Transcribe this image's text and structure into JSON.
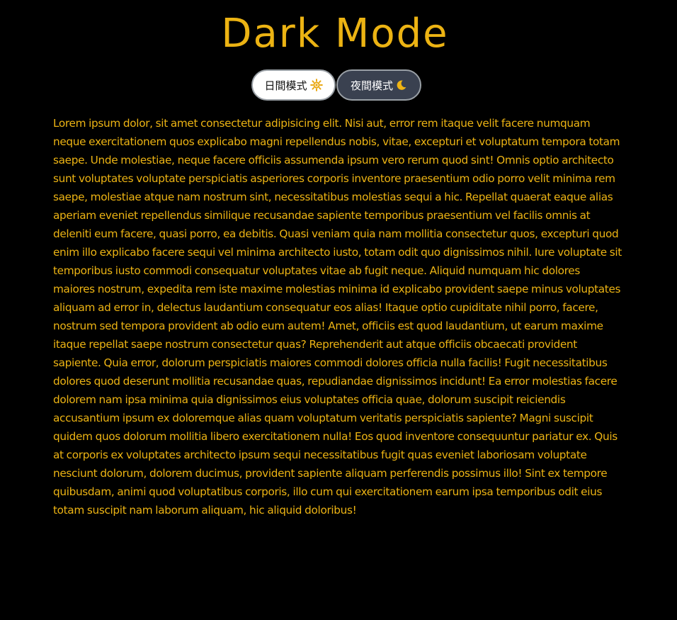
{
  "header": {
    "title": "Dark Mode"
  },
  "mode_toggle": {
    "light_label": "日間模式",
    "light_icon": "sun-icon",
    "dark_label": "夜間模式",
    "dark_icon": "moon-icon",
    "active": "dark"
  },
  "colors": {
    "background": "#000000",
    "accent": "#ecb313",
    "dark_button": "#3a4150",
    "light_button": "#ffffff"
  },
  "content": {
    "paragraph": "Lorem ipsum dolor, sit amet consectetur adipisicing elit. Nisi aut, error rem itaque velit facere numquam neque exercitationem quos explicabo magni repellendus nobis, vitae, excepturi et voluptatum tempora totam saepe. Unde molestiae, neque facere officiis assumenda ipsum vero rerum quod sint! Omnis optio architecto sunt voluptates voluptate perspiciatis asperiores corporis inventore praesentium odio porro velit minima rem saepe, molestiae atque nam nostrum sint, necessitatibus molestias sequi a hic. Repellat quaerat eaque alias aperiam eveniet repellendus similique recusandae sapiente temporibus praesentium vel facilis omnis at deleniti eum facere, quasi porro, ea debitis. Quasi veniam quia nam mollitia consectetur quos, excepturi quod enim illo explicabo facere sequi vel minima architecto iusto, totam odit quo dignissimos nihil. Iure voluptate sit temporibus iusto commodi consequatur voluptates vitae ab fugit neque. Aliquid numquam hic dolores maiores nostrum, expedita rem iste maxime molestias minima id explicabo provident saepe minus voluptates aliquam ad error in, delectus laudantium consequatur eos alias! Itaque optio cupiditate nihil porro, facere, nostrum sed tempora provident ab odio eum autem! Amet, officiis est quod laudantium, ut earum maxime itaque repellat saepe nostrum consectetur quas? Reprehenderit aut atque officiis obcaecati provident sapiente. Quia error, dolorum perspiciatis maiores commodi dolores officia nulla facilis! Fugit necessitatibus dolores quod deserunt mollitia recusandae quas, repudiandae dignissimos incidunt! Ea error molestias facere dolorem nam ipsa minima quia dignissimos eius voluptates officia quae, dolorum suscipit reiciendis accusantium ipsum ex doloremque alias quam voluptatum veritatis perspiciatis sapiente? Magni suscipit quidem quos dolorum mollitia libero exercitationem nulla! Eos quod inventore consequuntur pariatur ex. Quis at corporis ex voluptates architecto ipsum sequi necessitatibus fugit quas eveniet laboriosam voluptate nesciunt dolorum, dolorem ducimus, provident sapiente aliquam perferendis possimus illo! Sint ex tempore quibusdam, animi quod voluptatibus corporis, illo cum qui exercitationem earum ipsa temporibus odit eius totam suscipit nam laborum aliquam, hic aliquid doloribus!"
  }
}
